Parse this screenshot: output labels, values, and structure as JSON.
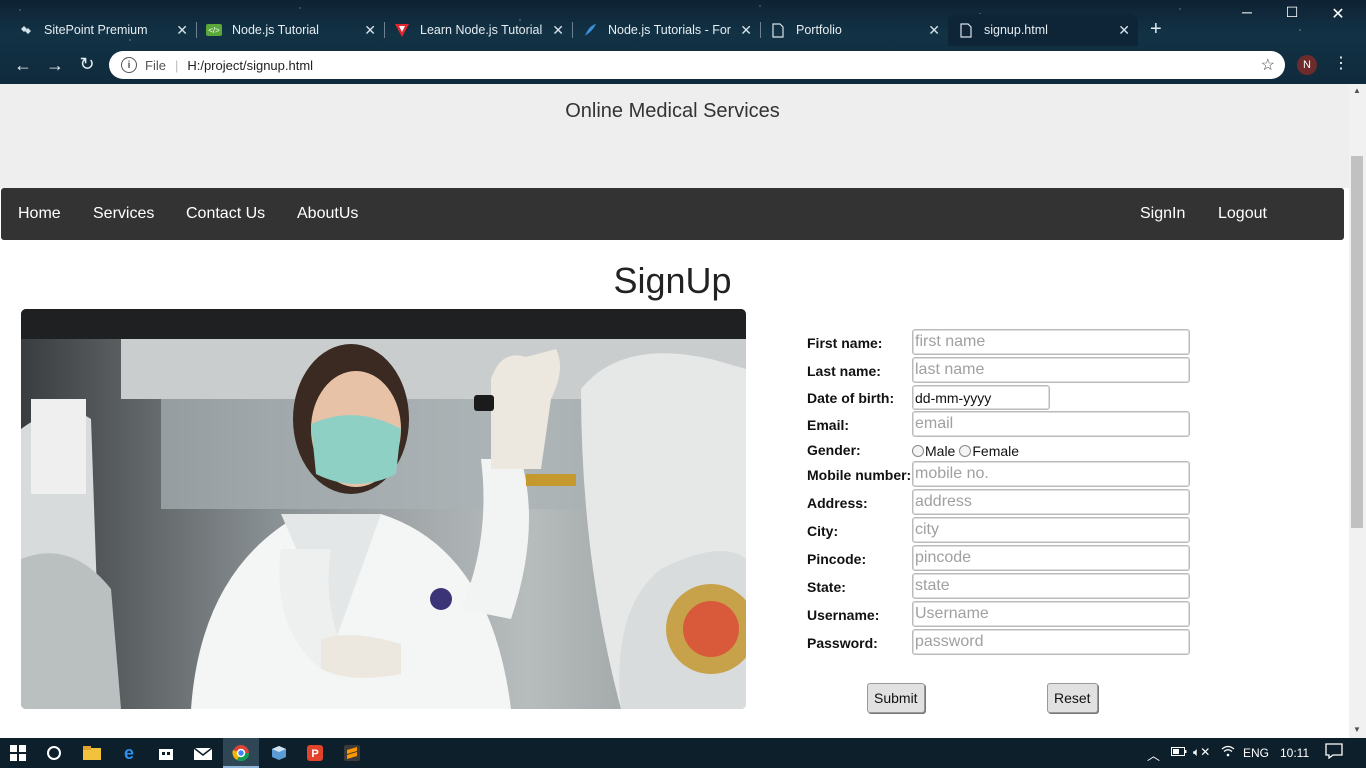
{
  "browser": {
    "tabs": [
      {
        "label": "SitePoint Premium",
        "icon": "sitepoint-icon",
        "active": false
      },
      {
        "label": "Node.js Tutorial",
        "icon": "nodejs-icon",
        "active": false
      },
      {
        "label": "Learn Node.js Tutorial",
        "icon": "red-v-icon",
        "active": false
      },
      {
        "label": "Node.js Tutorials - For",
        "icon": "feather-icon",
        "active": false
      },
      {
        "label": "Portfolio",
        "icon": "document-icon",
        "active": false
      },
      {
        "label": "signup.html",
        "icon": "document-icon",
        "active": true
      }
    ],
    "address": {
      "scheme": "File",
      "url": "H:/project/signup.html"
    },
    "profile_initial": "N"
  },
  "site": {
    "title": "Online Medical Services",
    "nav_left": [
      "Home",
      "Services",
      "Contact Us",
      "AboutUs"
    ],
    "nav_right": [
      "SignIn",
      "Logout"
    ]
  },
  "page": {
    "heading": "SignUp"
  },
  "form": {
    "first_name": {
      "label": "First name:",
      "placeholder": "first name"
    },
    "last_name": {
      "label": "Last name:",
      "placeholder": "last name"
    },
    "dob": {
      "label": "Date of birth:",
      "value": "dd-mm-yyyy"
    },
    "email": {
      "label": "Email:",
      "placeholder": "email"
    },
    "gender": {
      "label": "Gender:",
      "options": [
        "Male",
        "Female"
      ]
    },
    "mobile": {
      "label": "Mobile number:",
      "placeholder": "mobile no."
    },
    "address": {
      "label": "Address:",
      "placeholder": "address"
    },
    "city": {
      "label": "City:",
      "placeholder": "city"
    },
    "pincode": {
      "label": "Pincode:",
      "placeholder": "pincode"
    },
    "state": {
      "label": "State:",
      "placeholder": "state"
    },
    "username": {
      "label": "Username:",
      "placeholder": "Username"
    },
    "password": {
      "label": "Password:",
      "placeholder": "password"
    },
    "submit_label": "Submit",
    "reset_label": "Reset"
  },
  "taskbar": {
    "language": "ENG",
    "clock": "10:11"
  },
  "colors": {
    "navbar_bg": "#333333",
    "header_band_bg": "#eeeeee"
  }
}
